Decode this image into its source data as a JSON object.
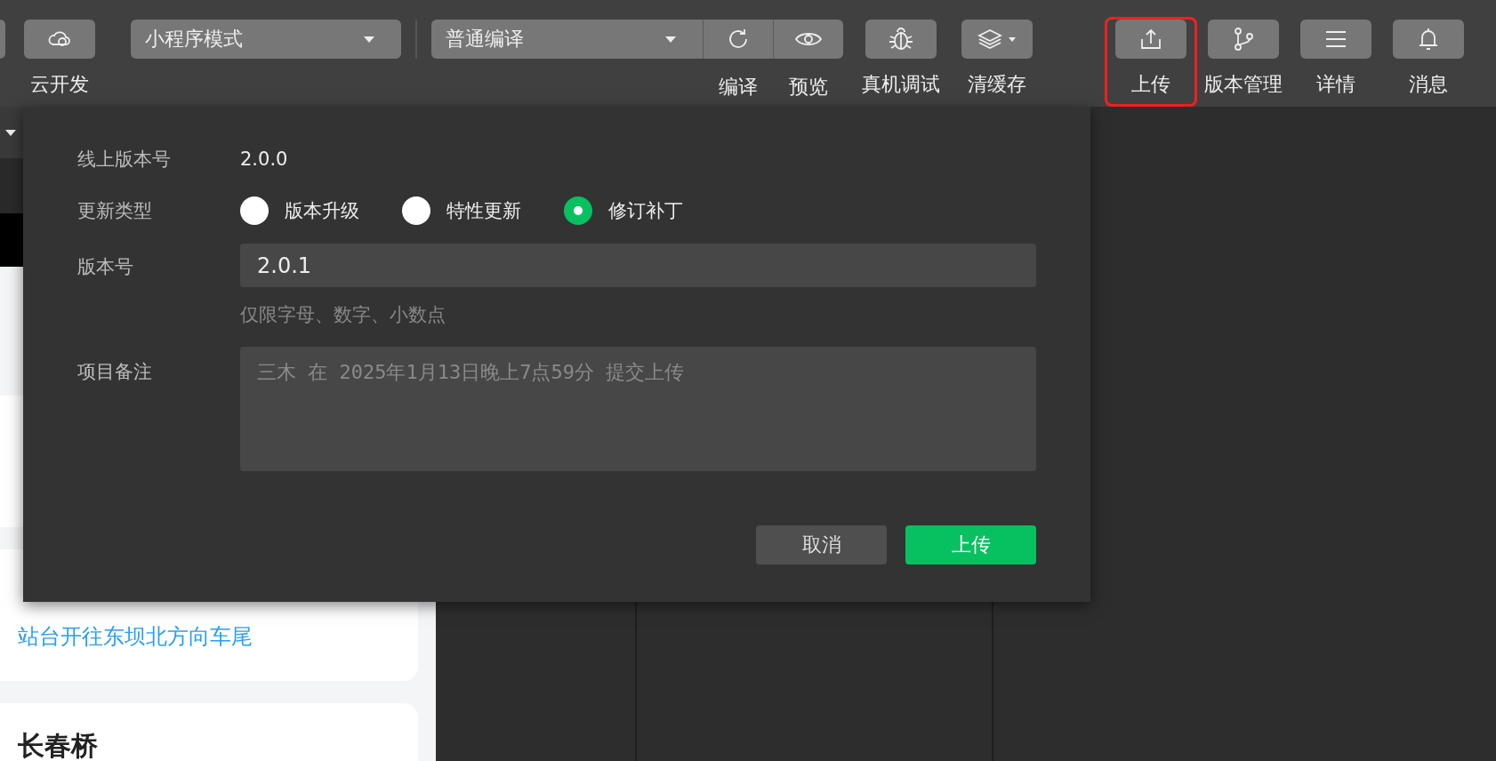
{
  "toolbar": {
    "left_tools": [
      {
        "label": "云开发"
      }
    ],
    "mode_select": {
      "value": "小程序模式"
    },
    "compile_select": {
      "value": "普通编译"
    },
    "compile_tools": [
      {
        "label": "编译"
      },
      {
        "label": "预览"
      }
    ],
    "tools": [
      {
        "label": "真机调试",
        "highlighted": false
      },
      {
        "label": "清缓存",
        "highlighted": false
      }
    ],
    "actions": [
      {
        "label": "上传",
        "highlighted": true
      },
      {
        "label": "版本管理",
        "highlighted": false
      },
      {
        "label": "详情",
        "highlighted": false
      },
      {
        "label": "消息",
        "highlighted": false
      }
    ]
  },
  "simulator": {
    "cards": [
      {
        "link": "站台开往东坝北方向车尾"
      },
      {
        "title": "长春桥"
      }
    ]
  },
  "dialog": {
    "online_version": {
      "label": "线上版本号",
      "value": "2.0.0"
    },
    "update_type": {
      "label": "更新类型",
      "options": [
        {
          "label": "版本升级",
          "selected": false
        },
        {
          "label": "特性更新",
          "selected": false
        },
        {
          "label": "修订补丁",
          "selected": true
        }
      ]
    },
    "version": {
      "label": "版本号",
      "value": "2.0.1",
      "hint": "仅限字母、数字、小数点"
    },
    "notes": {
      "label": "项目备注",
      "placeholder": "三木 在 2025年1月13日晚上7点59分 提交上传"
    },
    "buttons": [
      {
        "label": "取消",
        "kind": "secondary"
      },
      {
        "label": "上传",
        "kind": "primary"
      }
    ]
  }
}
